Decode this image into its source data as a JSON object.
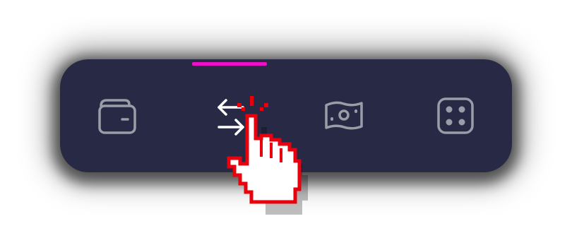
{
  "colors": {
    "bar_background": "#282a45",
    "active_indicator": "#ee10c8",
    "inactive_icon": "#9a9ca8",
    "active_icon": "#ffffff",
    "cursor_outline": "#e8000c"
  },
  "tabs": [
    {
      "icon": "wallet-icon",
      "active": false
    },
    {
      "icon": "transfer-arrows-icon",
      "active": true
    },
    {
      "icon": "banknote-icon",
      "active": false
    },
    {
      "icon": "dice-icon",
      "active": false
    }
  ],
  "cursor": {
    "icon": "pointing-hand-cursor-icon",
    "state": "clicking"
  }
}
